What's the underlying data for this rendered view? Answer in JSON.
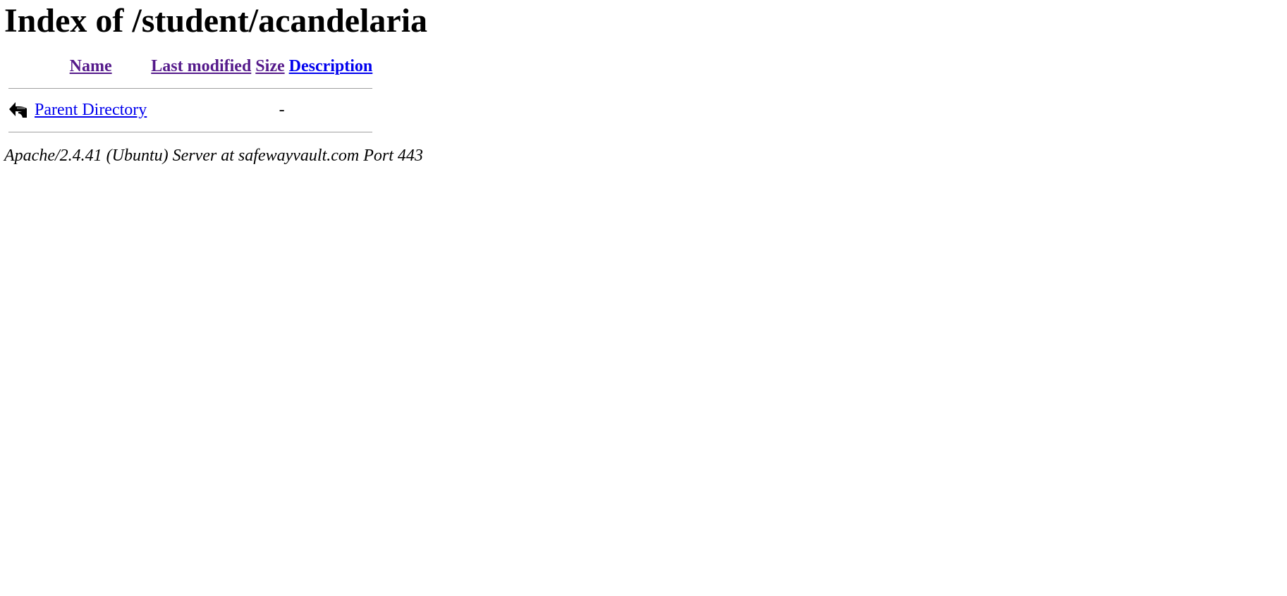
{
  "page": {
    "title": "Index of /student/acandelaria"
  },
  "table": {
    "headers": {
      "name": "Name",
      "last_modified": "Last modified",
      "size": "Size",
      "description": "Description"
    },
    "rows": [
      {
        "icon": "back-arrow-icon",
        "name": "Parent Directory",
        "last_modified": "",
        "size": "-",
        "description": ""
      }
    ]
  },
  "footer": {
    "server_signature": "Apache/2.4.41 (Ubuntu) Server at safewayvault.com Port 443"
  },
  "colors": {
    "visited_link": "#551a8b",
    "unvisited_link": "#0000ee",
    "separator": "#a0a0a0"
  }
}
